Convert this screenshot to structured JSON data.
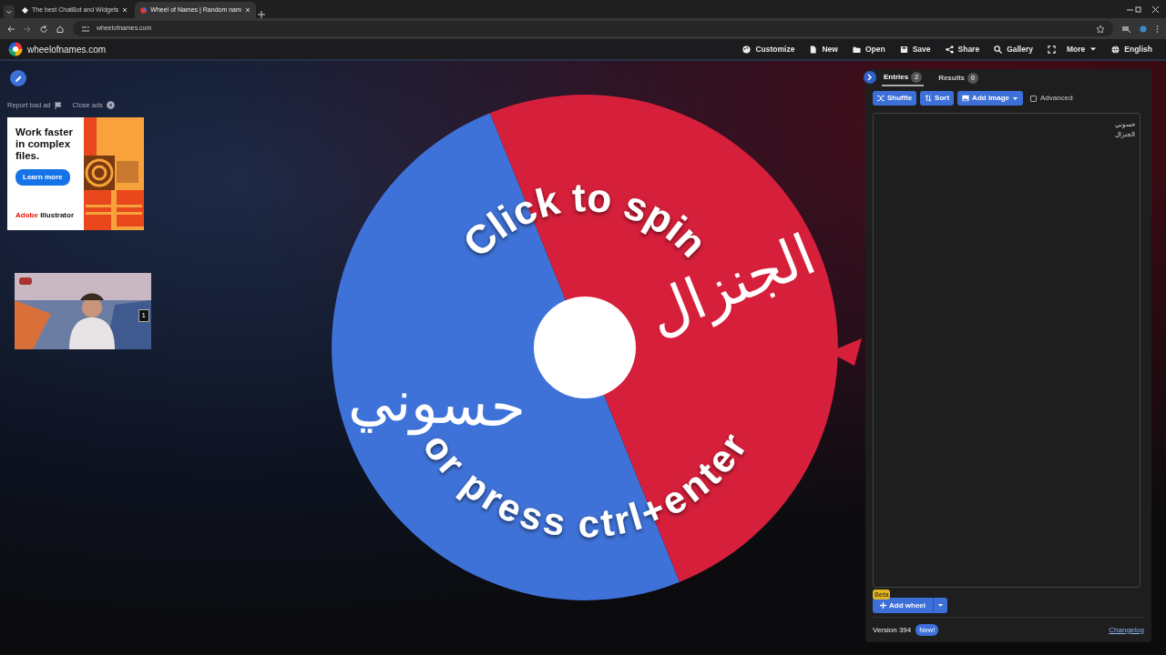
{
  "browser": {
    "tabs": [
      {
        "title": "The best ChatBot and Widgets",
        "selected": false
      },
      {
        "title": "Wheel of Names | Random nam",
        "selected": true
      }
    ],
    "address": "wheelofnames.com"
  },
  "site": {
    "logo_text": "wheelofnames.com",
    "nav": [
      {
        "kind": "button",
        "label": "Customize"
      },
      {
        "kind": "button",
        "label": "New"
      },
      {
        "kind": "button",
        "label": "Open"
      },
      {
        "kind": "button",
        "label": "Save"
      },
      {
        "kind": "button",
        "label": "Share"
      },
      {
        "kind": "button",
        "label": "Gallery"
      },
      {
        "kind": "icon"
      },
      {
        "kind": "menu",
        "label": "More"
      },
      {
        "kind": "button",
        "label": "English"
      }
    ]
  },
  "ads": {
    "report": "Report bad ad",
    "close": "Close ads",
    "banner": {
      "headline": "Work faster in complex files.",
      "button": "Learn more",
      "brand_a": "Adobe",
      "brand_b": "Illustrator"
    },
    "video_badge": "1"
  },
  "wheel": {
    "slices": [
      {
        "label": "حسوني",
        "color": "#3f72d8"
      },
      {
        "label": "الجنزال",
        "color": "#d61f3a"
      }
    ],
    "prompt_top": "Click to spin",
    "prompt_bottom": "or press ctrl+enter"
  },
  "panel": {
    "tabs": [
      {
        "label": "Entries",
        "count": "2",
        "selected": true
      },
      {
        "label": "Results",
        "count": "0",
        "selected": false
      }
    ],
    "buttons": [
      {
        "label": "Shuffle"
      },
      {
        "label": "Sort"
      },
      {
        "label": "Add image"
      }
    ],
    "advanced": {
      "label": "Advanced",
      "checked": false
    },
    "entries": [
      "حسوني",
      "الجنزال"
    ],
    "add_wheel": "Add wheel",
    "beta": "Beta",
    "version": "Version 394",
    "new_badge": "New!",
    "changelog": "Changelog"
  }
}
